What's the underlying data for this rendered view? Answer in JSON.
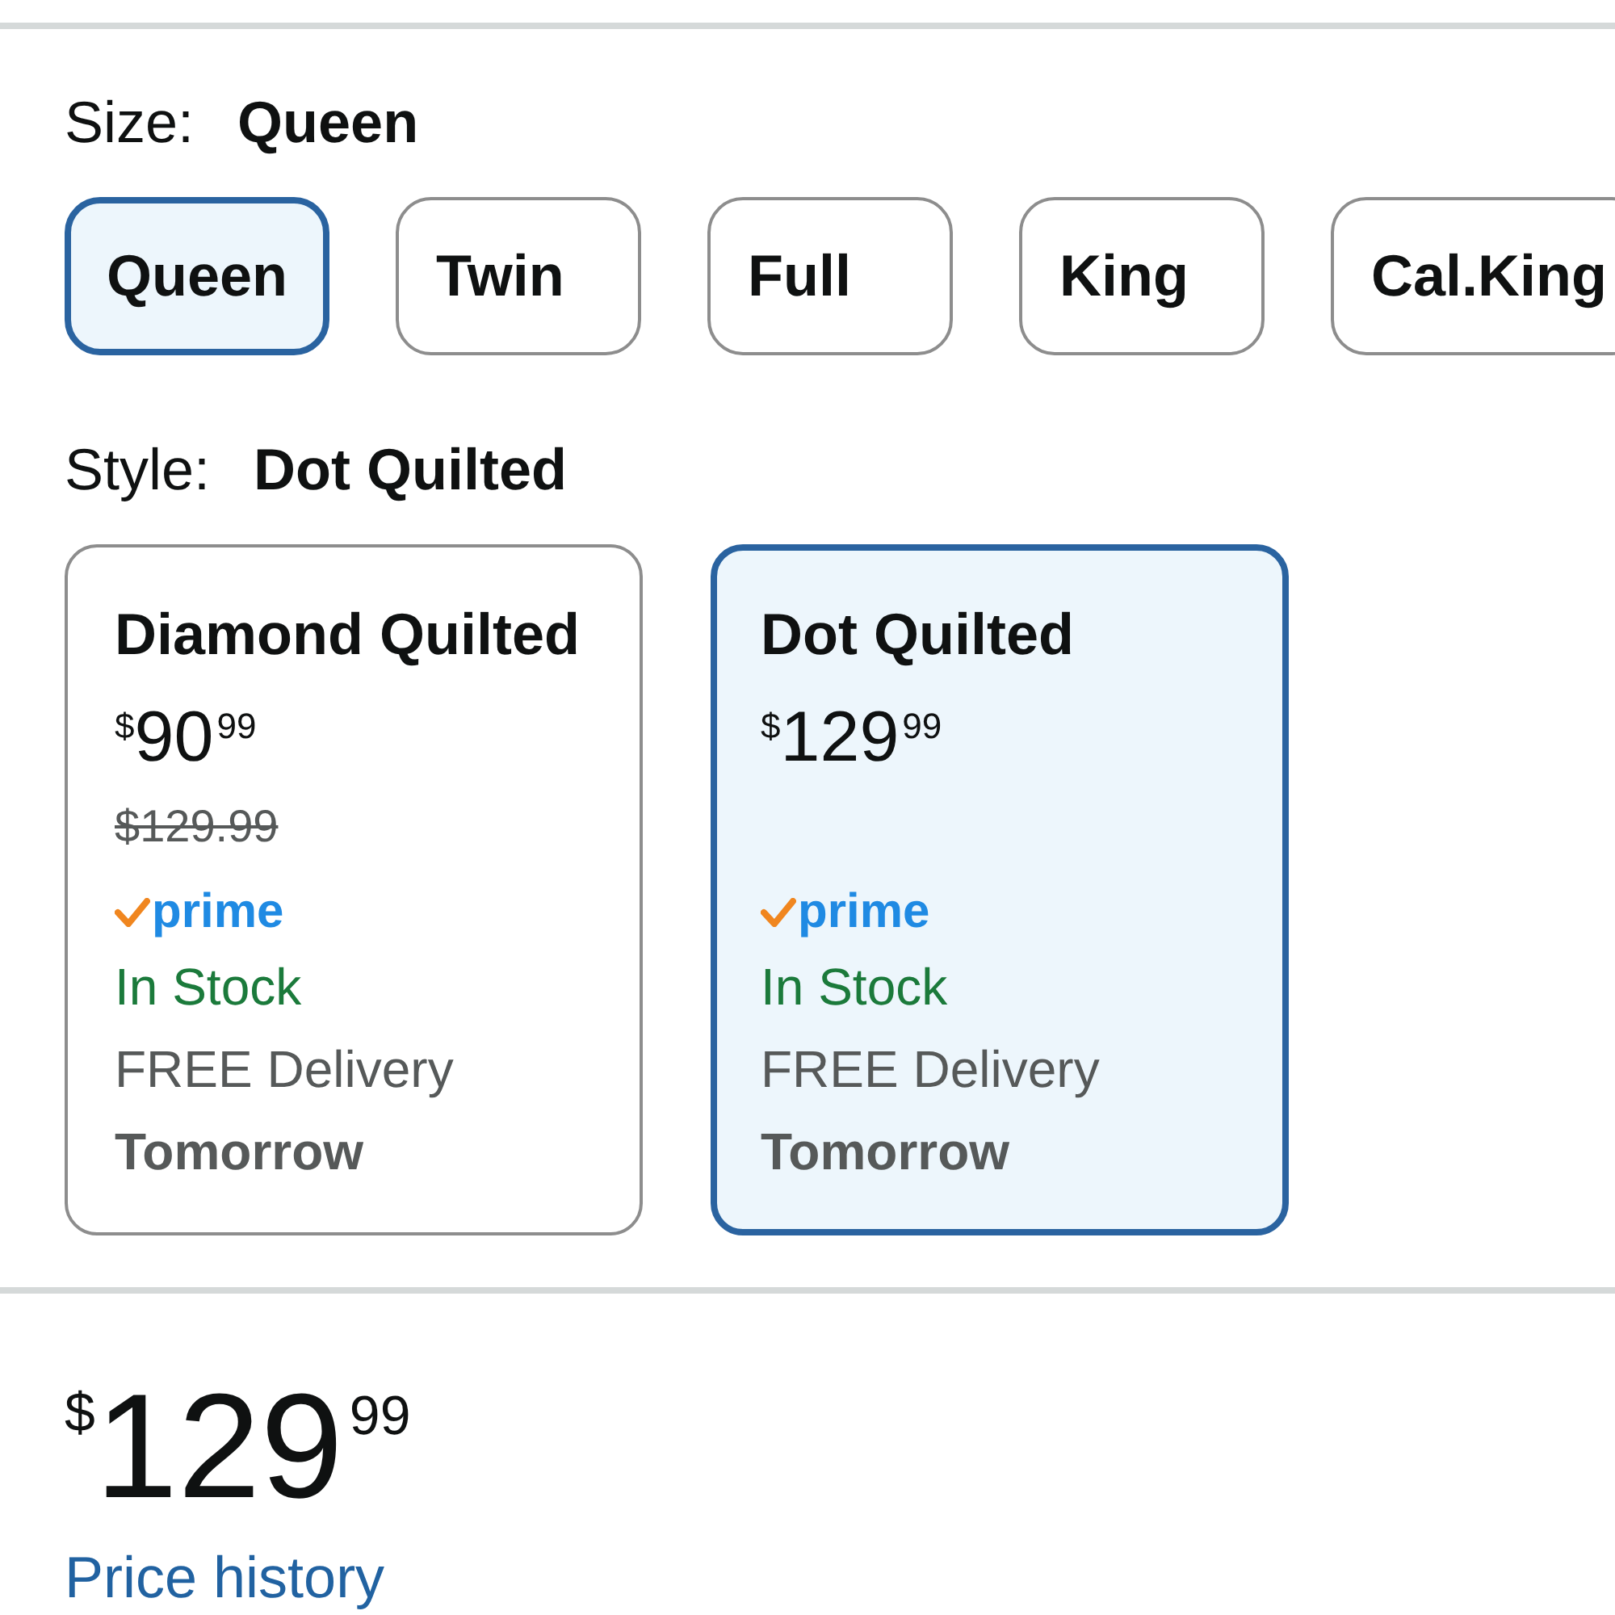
{
  "size": {
    "label": "Size:",
    "value": "Queen",
    "options": [
      {
        "label": "Queen",
        "selected": true
      },
      {
        "label": "Twin",
        "selected": false
      },
      {
        "label": "Full",
        "selected": false
      },
      {
        "label": "King",
        "selected": false
      },
      {
        "label": "Cal.King",
        "selected": false
      }
    ]
  },
  "style": {
    "label": "Style:",
    "value": "Dot Quilted",
    "options": [
      {
        "name": "Diamond Quilted",
        "price": {
          "currency": "$",
          "whole": "90",
          "fraction": "99"
        },
        "list_price": "$129.99",
        "badge": "prime",
        "availability": "In Stock",
        "delivery": "FREE Delivery",
        "delivery_date": "Tomorrow",
        "selected": false
      },
      {
        "name": "Dot Quilted",
        "price": {
          "currency": "$",
          "whole": "129",
          "fraction": "99"
        },
        "badge": "prime",
        "availability": "In Stock",
        "delivery": "FREE Delivery",
        "delivery_date": "Tomorrow",
        "selected": true
      }
    ]
  },
  "price": {
    "currency": "$",
    "whole": "129",
    "fraction": "99"
  },
  "price_history_link": "Price history"
}
